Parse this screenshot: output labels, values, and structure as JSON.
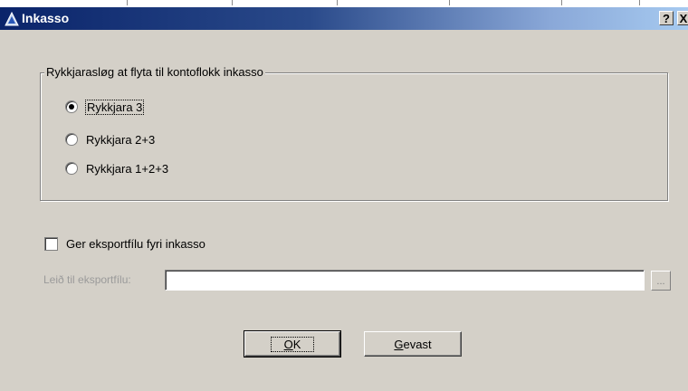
{
  "window": {
    "title": "Inkasso",
    "help_label": "?",
    "close_label": "X"
  },
  "group": {
    "legend": "Rykkjarasløg at flyta til kontoflokk inkasso",
    "options": [
      {
        "label": "Rykkjara 3",
        "selected": true
      },
      {
        "label": "Rykkjara 2+3",
        "selected": false
      },
      {
        "label": "Rykkjara 1+2+3",
        "selected": false
      }
    ]
  },
  "export": {
    "checkbox_label": "Ger eksportfílu fyri inkasso",
    "checked": false,
    "path_label": "Leið til eksportfílu:",
    "path_value": "",
    "browse_label": "..."
  },
  "buttons": {
    "ok_mnemonic": "O",
    "ok_rest": "K",
    "cancel_mnemonic": "G",
    "cancel_rest": "evast"
  },
  "colors": {
    "titlebar_start": "#0a246a",
    "titlebar_end": "#a6caf0",
    "dialog_bg": "#d4d0c8"
  }
}
